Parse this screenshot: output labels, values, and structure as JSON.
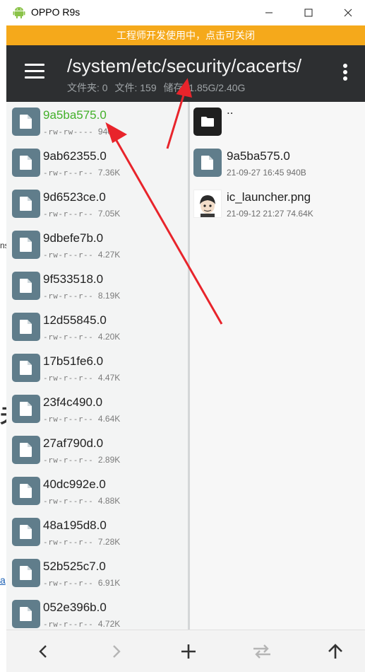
{
  "window": {
    "title": "OPPO R9s",
    "minimize": "—",
    "maximize": "☐",
    "close": "✕"
  },
  "banner": {
    "text": "工程师开发使用中，点击可关闭"
  },
  "appbar": {
    "path": "/system/etc/security/cacerts/",
    "stats": {
      "folders": "文件夹: 0",
      "files": "文件: 159",
      "storage": "储存: 1.85G/2.40G"
    }
  },
  "left_pane": {
    "files": [
      {
        "name": "9a5ba575.0",
        "perm": "-rw-rw----",
        "size": "940B",
        "selected": true
      },
      {
        "name": "9ab62355.0",
        "perm": "-rw-r--r--",
        "size": "7.36K"
      },
      {
        "name": "9d6523ce.0",
        "perm": "-rw-r--r--",
        "size": "7.05K"
      },
      {
        "name": "9dbefe7b.0",
        "perm": "-rw-r--r--",
        "size": "4.27K"
      },
      {
        "name": "9f533518.0",
        "perm": "-rw-r--r--",
        "size": "8.19K"
      },
      {
        "name": "12d55845.0",
        "perm": "-rw-r--r--",
        "size": "4.20K"
      },
      {
        "name": "17b51fe6.0",
        "perm": "-rw-r--r--",
        "size": "4.47K"
      },
      {
        "name": "23f4c490.0",
        "perm": "-rw-r--r--",
        "size": "4.64K"
      },
      {
        "name": "27af790d.0",
        "perm": "-rw-r--r--",
        "size": "2.89K"
      },
      {
        "name": "40dc992e.0",
        "perm": "-rw-r--r--",
        "size": "4.88K"
      },
      {
        "name": "48a195d8.0",
        "perm": "-rw-r--r--",
        "size": "7.28K"
      },
      {
        "name": "52b525c7.0",
        "perm": "-rw-r--r--",
        "size": "6.91K"
      },
      {
        "name": "052e396b.0",
        "perm": "-rw-r--r--",
        "size": "4.72K"
      }
    ]
  },
  "right_pane": {
    "parent": "..",
    "files": [
      {
        "name": "9a5ba575.0",
        "meta": "21-09-27 16:45  940B",
        "icon": "file-icon"
      },
      {
        "name": "ic_launcher.png",
        "meta": "21-09-12 21:27  74.64K",
        "icon": "image-thumbnail"
      }
    ]
  },
  "bottom_nav": {
    "back": "‹",
    "forward": "›",
    "add": "+",
    "swap": "⇄",
    "up": "↑"
  },
  "colors": {
    "banner": "#f5a91b",
    "appbar": "#2d2f31",
    "selected": "#43b02a",
    "file_icon": "#607d8b",
    "annotation": "#e8242b"
  }
}
